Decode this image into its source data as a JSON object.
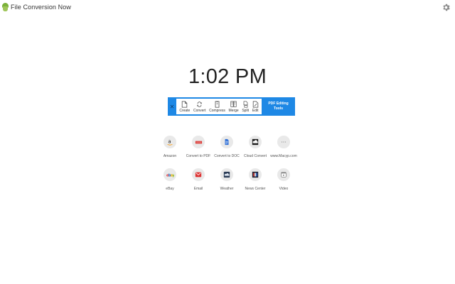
{
  "header": {
    "app_title": "File Conversion Now",
    "logo_icon": "cup-icon",
    "settings_icon": "gear-icon"
  },
  "clock": {
    "time": "1:02 PM"
  },
  "toolbar": {
    "close_label": "✕",
    "title_line1": "PDF Editing",
    "title_line2": "Tools",
    "accent_color": "#1e88e5",
    "buttons": [
      {
        "label": "Create",
        "icon": "create-file-icon"
      },
      {
        "label": "Convert",
        "icon": "convert-icon"
      },
      {
        "label": "Compress",
        "icon": "compress-icon"
      },
      {
        "label": "Merge",
        "icon": "merge-icon"
      },
      {
        "label": "Split",
        "icon": "split-icon"
      },
      {
        "label": "Edit",
        "icon": "edit-icon"
      }
    ]
  },
  "shortcuts": [
    {
      "label": "Amazon",
      "icon": "amazon-icon"
    },
    {
      "label": "Convert to PDF",
      "icon": "pdf-icon"
    },
    {
      "label": "Convert to DOC",
      "icon": "doc-icon"
    },
    {
      "label": "Cloud Convert",
      "icon": "cloud-convert-icon"
    },
    {
      "label": "www.Macyp.com",
      "icon": "website-icon"
    },
    {
      "label": "eBay",
      "icon": "ebay-icon"
    },
    {
      "label": "Email",
      "icon": "email-icon"
    },
    {
      "label": "Weather",
      "icon": "weather-icon"
    },
    {
      "label": "News Center",
      "icon": "news-icon"
    },
    {
      "label": "Video",
      "icon": "video-icon"
    }
  ]
}
